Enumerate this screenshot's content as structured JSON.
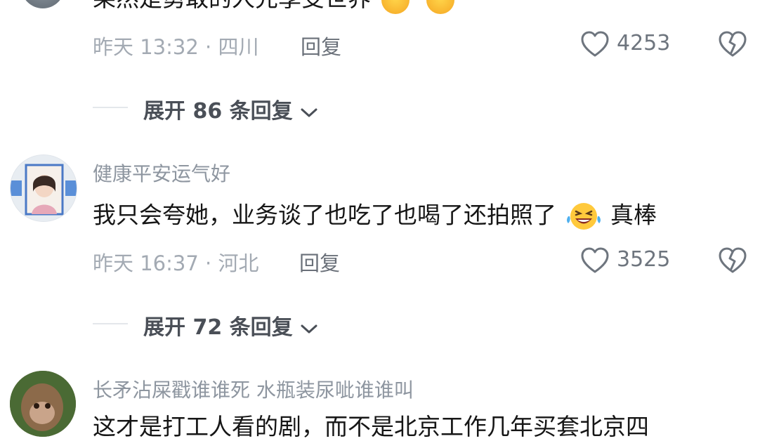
{
  "comments": [
    {
      "content_partial": "果然是勇敢的人先享受世界",
      "time_location": "昨天 13:32 · 四川",
      "reply_label": "回复",
      "likes": "4253",
      "expand": "展开 86 条回复"
    },
    {
      "username": "健康平安运气好",
      "content_before": "我只会夸她，业务谈了也吃了也喝了还拍照了",
      "content_after": "真棒",
      "time_location": "昨天 16:37 · 河北",
      "reply_label": "回复",
      "likes": "3525",
      "expand": "展开 72 条回复"
    },
    {
      "username": "长矛沾屎戳谁谁死  水瓶装尿呲谁谁叫",
      "content_partial": "这才是打工人看的剧，而不是北京工作几年买套北京四"
    }
  ],
  "icons": {
    "like": "heart-outline-icon",
    "dislike": "broken-heart-icon",
    "expand": "chevron-down-icon",
    "emoji_laugh": "laughing-tears-emoji",
    "emoji_star": "star-struck-emoji"
  },
  "colors": {
    "username": "#8e96a0",
    "meta": "#a3aab3",
    "text": "#161616"
  }
}
